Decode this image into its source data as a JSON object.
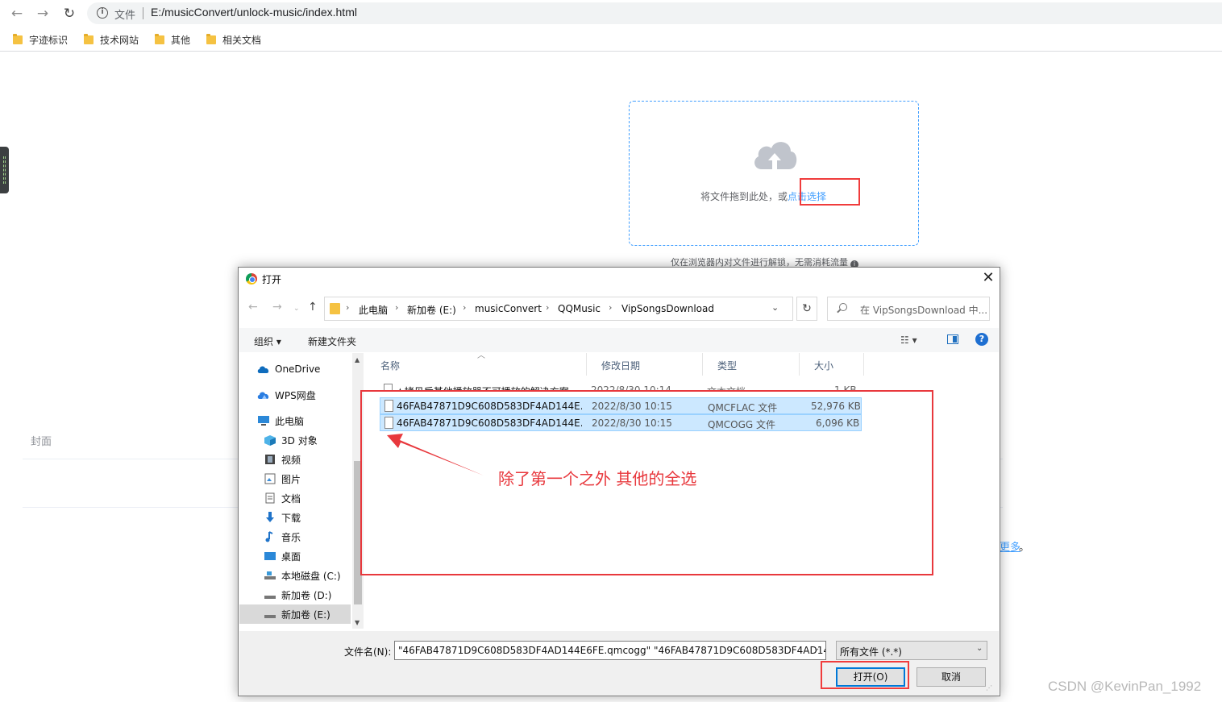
{
  "browser": {
    "scheme_label": "文件",
    "url": "E:/musicConvert/unlock-music/index.html",
    "bookmarks": [
      "字迹标识",
      "技术网站",
      "其他",
      "相关文档"
    ]
  },
  "page": {
    "upload_text": "将文件拖到此处，或",
    "upload_link": "点击选择",
    "upload_tip": "仅在浏览器内对文件进行解锁，无需消耗流量",
    "cover_label": "封面",
    "more_link": "更多",
    "more_suffix": "。",
    "watermark": "CSDN @KevinPan_1992"
  },
  "dialog": {
    "title": "打开",
    "breadcrumb": [
      "此电脑",
      "新加卷 (E:)",
      "musicConvert",
      "QQMusic",
      "VipSongsDownload"
    ],
    "search_placeholder": "在 VipSongsDownload 中...",
    "toolbar": {
      "organize": "组织 ▾",
      "new_folder": "新建文件夹"
    },
    "nav_items": [
      {
        "label": "OneDrive",
        "icon": "cloud-icon"
      },
      {
        "label": "WPS网盘",
        "icon": "wps-cloud-icon"
      },
      {
        "label": "此电脑",
        "icon": "computer-icon"
      },
      {
        "label": "3D 对象",
        "icon": "3d-objects-icon"
      },
      {
        "label": "视频",
        "icon": "video-icon"
      },
      {
        "label": "图片",
        "icon": "pictures-icon"
      },
      {
        "label": "文档",
        "icon": "documents-icon"
      },
      {
        "label": "下载",
        "icon": "download-icon"
      },
      {
        "label": "音乐",
        "icon": "music-icon"
      },
      {
        "label": "桌面",
        "icon": "desktop-icon"
      },
      {
        "label": "本地磁盘 (C:)",
        "icon": "drive-icon"
      },
      {
        "label": "新加卷 (D:)",
        "icon": "drive-icon"
      },
      {
        "label": "新加卷 (E:)",
        "icon": "drive-icon"
      }
    ],
    "columns": [
      "名称",
      "修改日期",
      "类型",
      "大小"
    ],
    "files": [
      {
        "name": "★拷贝后其他播放器不可播放的解决方案",
        "date": "2022/8/30 10:14",
        "type": "文本文档",
        "size": "1 KB",
        "selected": false
      },
      {
        "name": "46FAB47871D9C608D583DF4AD144E...",
        "date": "2022/8/30 10:15",
        "type": "QMCFLAC 文件",
        "size": "52,976 KB",
        "selected": true
      },
      {
        "name": "46FAB47871D9C608D583DF4AD144E...",
        "date": "2022/8/30 10:15",
        "type": "QMCOGG 文件",
        "size": "6,096 KB",
        "selected": true
      }
    ],
    "filename_label": "文件名(N):",
    "filename_value": "\"46FAB47871D9C608D583DF4AD144E6FE.qmcogg\" \"46FAB47871D9C608D583DF4AD144",
    "filetype_value": "所有文件 (*.*)",
    "open_button": "打开(O)",
    "cancel_button": "取消"
  },
  "annotation": {
    "text": "除了第一个之外 其他的全选",
    "color": "#e8383d"
  }
}
